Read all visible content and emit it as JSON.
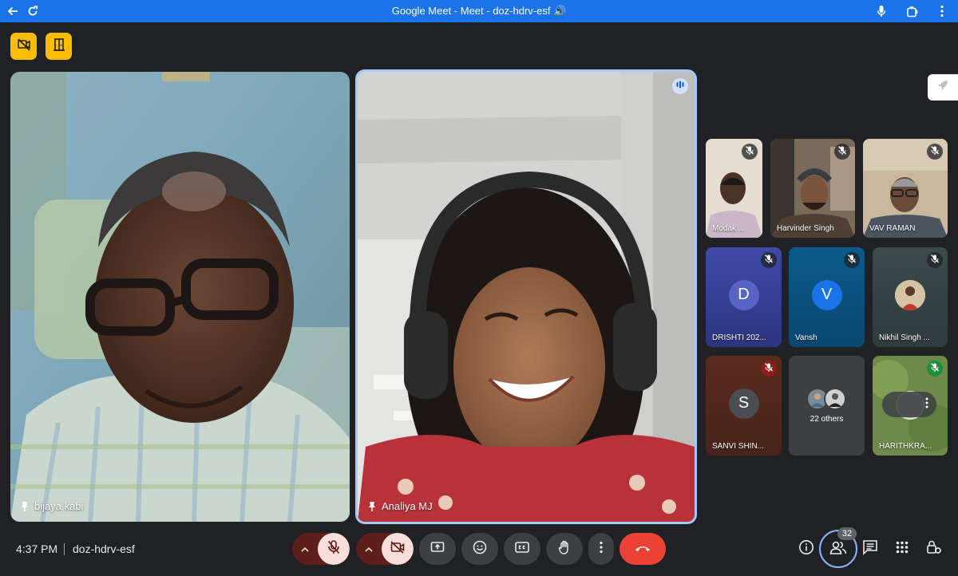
{
  "window": {
    "title": "Google Meet - Meet - doz-hdrv-esf 🔊"
  },
  "main_tiles": [
    {
      "name": "bijaya kabi"
    },
    {
      "name": "Analiya MJ"
    }
  ],
  "grid_tiles": [
    {
      "name": "Modak ..."
    },
    {
      "name": "Harvinder Singh"
    },
    {
      "name": "VAV RAMAN"
    },
    {
      "name": "DRISHTI 202...",
      "initial": "D"
    },
    {
      "name": "Vansh",
      "initial": "V"
    },
    {
      "name": "Nikhil Singh ..."
    },
    {
      "name": "SANVI SHIN...",
      "initial": "S"
    },
    {
      "name": "22 others"
    },
    {
      "name": "HARITHKRA..."
    }
  ],
  "footer": {
    "time": "4:37 PM",
    "meeting_code": "doz-hdrv-esf",
    "participant_count": "32"
  },
  "colors": {
    "titlebar": "#1a73e8",
    "background": "#202124",
    "end_call": "#ea4335",
    "muted_bg": "#f9dedc",
    "muted_arrow_bg": "#5c1f1c",
    "speaking_border": "#a8c7fa",
    "badge": "#fbbc04"
  }
}
